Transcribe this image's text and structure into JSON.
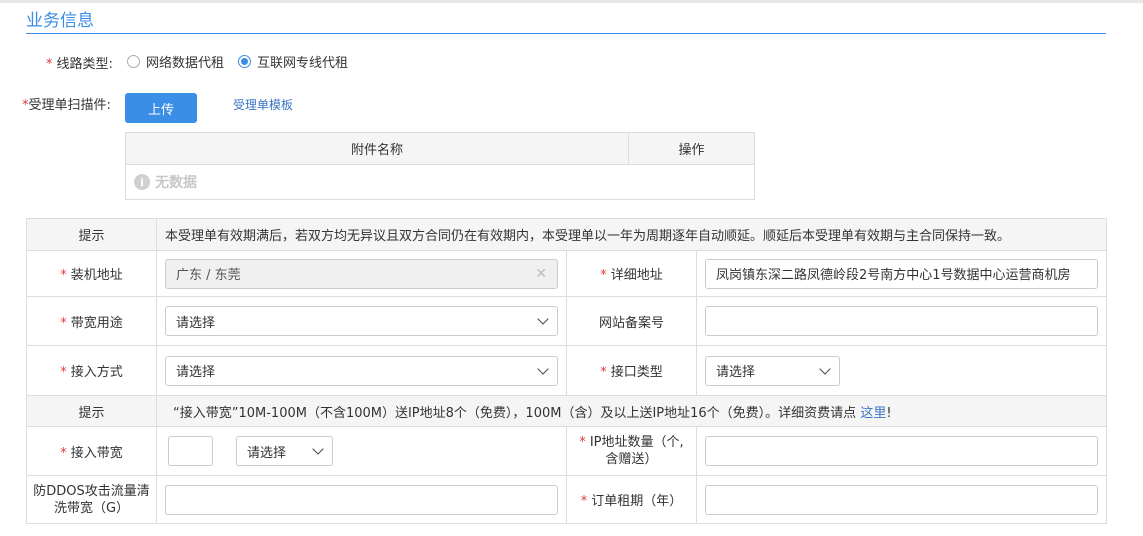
{
  "section": {
    "title": "业务信息"
  },
  "line_type": {
    "label": "线路类型:",
    "options": [
      "网络数据代租",
      "互联网专线代租"
    ],
    "selected_index": 1
  },
  "scan": {
    "label": "受理单扫描件:",
    "upload_label": "上传",
    "template_link": "受理单模板"
  },
  "attachments": {
    "col_name": "附件名称",
    "col_action": "操作",
    "empty_text": "无数据"
  },
  "form": {
    "tip_label": "提示",
    "tip1": "本受理单有效期满后，若双方均无异议且双方合同仍在有效期内，本受理单以一年为周期逐年自动顺延。顺延后本受理单有效期与主合同保持一致。",
    "install_address": {
      "label": "装机地址",
      "value": "广东 / 东莞"
    },
    "detail_address": {
      "label": "详细地址",
      "value": "凤岗镇东深二路凤德岭段2号南方中心1号数据中心运营商机房"
    },
    "bandwidth_use": {
      "label": "带宽用途",
      "value": "请选择"
    },
    "site_record": {
      "label": "网站备案号",
      "value": ""
    },
    "access_mode": {
      "label": "接入方式",
      "value": "请选择"
    },
    "interface_type": {
      "label": "接口类型",
      "value": "请选择"
    },
    "tip2_text": "“接入带宽”10M-100M（不含100M）送IP地址8个（免费），100M（含）及以上送IP地址16个（免费）。详细资费请点 ",
    "tip2_link": "这里",
    "tip2_end": "!",
    "access_bandwidth": {
      "label": "接入带宽",
      "value": "",
      "unit_value": "请选择"
    },
    "ip_count": {
      "label": "IP地址数量（个,含赠送）",
      "value": ""
    },
    "ddos": {
      "label": "防DDOS攻击流量清洗带宽（G）",
      "value": ""
    },
    "order_term": {
      "label": "订单租期（年）",
      "value": ""
    }
  }
}
